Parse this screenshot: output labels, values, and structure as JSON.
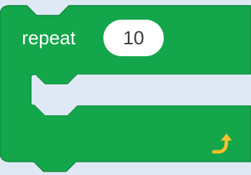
{
  "block": {
    "type": "repeat",
    "label": "repeat",
    "count_value": "10",
    "loop_icon": "loop-arrow-icon",
    "colors": {
      "block_fill": "#14a64a",
      "block_stroke": "#0f8a3c",
      "workspace_bg": "#dfe8f5",
      "arrow": "#f6c02b",
      "input_bg": "#ffffff",
      "input_text": "#3a3a3a"
    }
  }
}
